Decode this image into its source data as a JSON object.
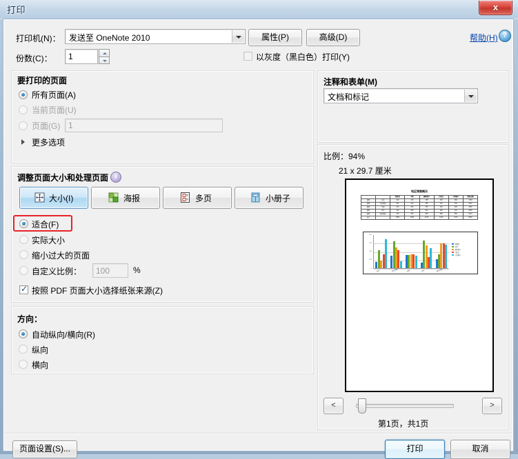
{
  "window": {
    "title": "打印",
    "close_label": "x"
  },
  "printer": {
    "label": "打印机(N)：",
    "selected": "发送至 OneNote 2010",
    "properties_label": "属性(P)",
    "advanced_label": "高级(D)",
    "help_label": "帮助(H)",
    "help_icon": "question-mark-icon"
  },
  "copies": {
    "label": "份数(C)：",
    "value": "1",
    "grayscale_label": "以灰度（黑白色）打印(Y)",
    "grayscale_checked": false
  },
  "pages_group": {
    "title": "要打印的页面",
    "options": [
      {
        "label": "所有页面(A)",
        "selected": true,
        "disabled": false
      },
      {
        "label": "当前页面(U)",
        "selected": false,
        "disabled": true
      },
      {
        "label": "页面(G)",
        "selected": false,
        "disabled": true
      }
    ],
    "pages_value": "1",
    "more_options_label": "更多选项"
  },
  "sizing_group": {
    "title": "调整页面大小和处理页面",
    "info_icon": "info-icon",
    "buttons": [
      {
        "label": "大小(I)",
        "icon": "resize-icon",
        "selected": true
      },
      {
        "label": "海报",
        "icon": "poster-icon",
        "selected": false
      },
      {
        "label": "多页",
        "icon": "multipage-icon",
        "selected": false
      },
      {
        "label": "小册子",
        "icon": "booklet-icon",
        "selected": false
      }
    ],
    "options": [
      {
        "label": "适合(F)",
        "selected": true,
        "highlighted": true
      },
      {
        "label": "实际大小",
        "selected": false,
        "highlighted": false
      },
      {
        "label": "缩小过大的页面",
        "selected": false,
        "highlighted": false
      },
      {
        "label": "自定义比例：",
        "selected": false,
        "highlighted": false
      }
    ],
    "custom_scale_value": "100",
    "percent_symbol": "%",
    "paper_source_label": "按照 PDF 页面大小选择纸张来源(Z)",
    "paper_source_checked": true
  },
  "orientation_group": {
    "title": "方向：",
    "options": [
      {
        "label": "自动纵向/横向(R)",
        "selected": true
      },
      {
        "label": "纵向",
        "selected": false
      },
      {
        "label": "横向",
        "selected": false
      }
    ]
  },
  "comments_group": {
    "title": "注释和表单(M)",
    "selected": "文档和标记"
  },
  "preview": {
    "scale_label": "比例：94%",
    "dimensions": "21 x 29.7 厘米",
    "page_indicator": "第1页，共1页",
    "prev_label": "<",
    "next_label": ">"
  },
  "footer": {
    "page_setup_label": "页面设置(S)...",
    "print_label": "打印",
    "cancel_label": "取消"
  },
  "chart_data": {
    "type": "bar",
    "title": "地区销售概况",
    "categories": [
      "东北",
      "华北地区",
      "华南",
      "华东",
      "西北地区"
    ],
    "series": [
      {
        "name": "消费者",
        "color": "#1f77d0",
        "values": [
          140,
          290,
          310,
          130,
          215
        ]
      },
      {
        "name": "中型",
        "color": "#6aa62b",
        "values": [
          420,
          640,
          305,
          655,
          330
        ]
      },
      {
        "name": "国际客户",
        "color": "#f0a020",
        "values": [
          185,
          495,
          325,
          540,
          580
        ]
      },
      {
        "name": "行政方",
        "color": "#e8492c",
        "values": [
          325,
          430,
          320,
          255,
          585
        ]
      },
      {
        "name": "小型客户",
        "color": "#2cb8d8",
        "values": [
          690,
          160,
          290,
          470,
          560
        ]
      }
    ],
    "ylim": [
      0,
      800
    ],
    "yticks": [
      "800",
      "600",
      "400",
      "200",
      "0"
    ],
    "legend_position": "right",
    "grid": true,
    "table_headers": [
      "",
      "",
      "消费者",
      "中型",
      "国际客户",
      "行政方",
      "小型客户",
      "销售总额"
    ],
    "table_rows": [
      [
        "销售",
        "东北",
        "140",
        "420",
        "185",
        "325",
        "690",
        "1760"
      ],
      [
        "销售",
        "华北地区",
        "290",
        "640",
        "495",
        "430",
        "160",
        "2015"
      ],
      [
        "销售",
        "华南",
        "310",
        "305",
        "325",
        "320",
        "290",
        "1550"
      ],
      [
        "销售",
        "华东",
        "130",
        "655",
        "540",
        "255",
        "470",
        "2050"
      ],
      [
        "销售",
        "西北地区",
        "215",
        "330",
        "580",
        "585",
        "560",
        "2270"
      ],
      [
        "总计",
        "",
        "1085",
        "2350",
        "2125",
        "1915",
        "2170",
        "9645"
      ]
    ]
  }
}
